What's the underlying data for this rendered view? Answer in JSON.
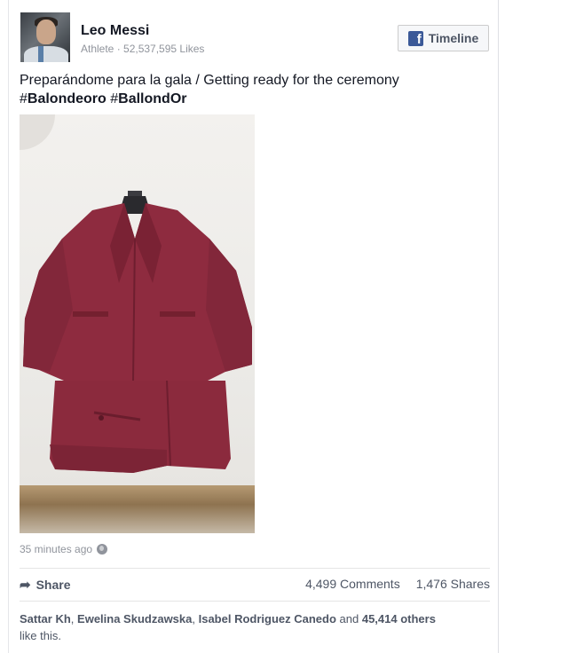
{
  "post": {
    "author": "Leo Messi",
    "meta": "Athlete · 52,537,595 Likes",
    "timeline_label": "Timeline",
    "text_line1": "Preparándome para la gala / Getting ready for the ceremony",
    "hashtag1_hash": "#",
    "hashtag1_word": "Balondeoro",
    "hashtag2_hash": "#",
    "hashtag2_word": "BallondOr",
    "timestamp": "35 minutes ago",
    "share_label": "Share",
    "comments": "4,499 Comments",
    "shares": "1,476 Shares",
    "likers": [
      "Sattar Kh",
      "Ewelina Skudzawska",
      "Isabel Rodriguez Canedo"
    ],
    "and_text": " and ",
    "others": "45,414 others",
    "like_suffix": "like this.",
    "icons": {
      "brand": "facebook-icon",
      "privacy": "globe-icon",
      "share": "share-arrow-icon"
    },
    "colors": {
      "fb_blue": "#3b5998",
      "suit": "#8e2b3f"
    }
  }
}
